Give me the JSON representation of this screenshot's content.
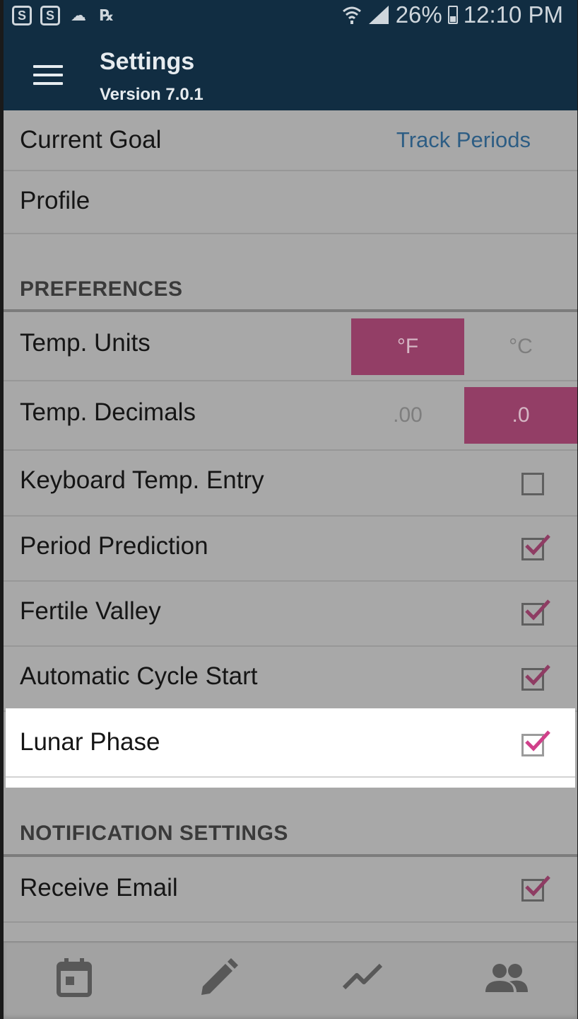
{
  "status_bar": {
    "left_icons": [
      "skype-icon",
      "skype-business-icon",
      "cloud-sync-icon",
      "prescription-icon"
    ],
    "battery": "26%",
    "time": "12:10 PM"
  },
  "app_bar": {
    "title": "Settings",
    "version": "Version 7.0.1"
  },
  "rows": {
    "current_goal": {
      "label": "Current Goal",
      "value": "Track Periods"
    },
    "profile": {
      "label": "Profile"
    }
  },
  "sections": {
    "preferences": "PREFERENCES",
    "notifications": "NOTIFICATION SETTINGS"
  },
  "preferences": {
    "temp_units": {
      "label": "Temp. Units",
      "options": [
        "°F",
        "°C"
      ],
      "selected": "°F"
    },
    "temp_decimals": {
      "label": "Temp. Decimals",
      "options": [
        ".00",
        ".0"
      ],
      "selected": ".0"
    },
    "keyboard_temp_entry": {
      "label": "Keyboard Temp. Entry",
      "checked": false
    },
    "period_prediction": {
      "label": "Period Prediction",
      "checked": true
    },
    "fertile_valley": {
      "label": "Fertile Valley",
      "checked": true
    },
    "automatic_cycle_start": {
      "label": "Automatic Cycle Start",
      "checked": true
    },
    "lunar_phase": {
      "label": "Lunar Phase",
      "checked": true
    }
  },
  "notifications": {
    "receive_email": {
      "label": "Receive Email",
      "checked": true
    }
  },
  "bottom_nav": [
    "calendar-icon",
    "pencil-icon",
    "chart-icon",
    "community-icon"
  ],
  "colors": {
    "app_bar": "#112d42",
    "accent": "#933e66",
    "check": "#b13d74",
    "link": "#2d5d84",
    "dim_overlay": "#a8a8a8"
  }
}
